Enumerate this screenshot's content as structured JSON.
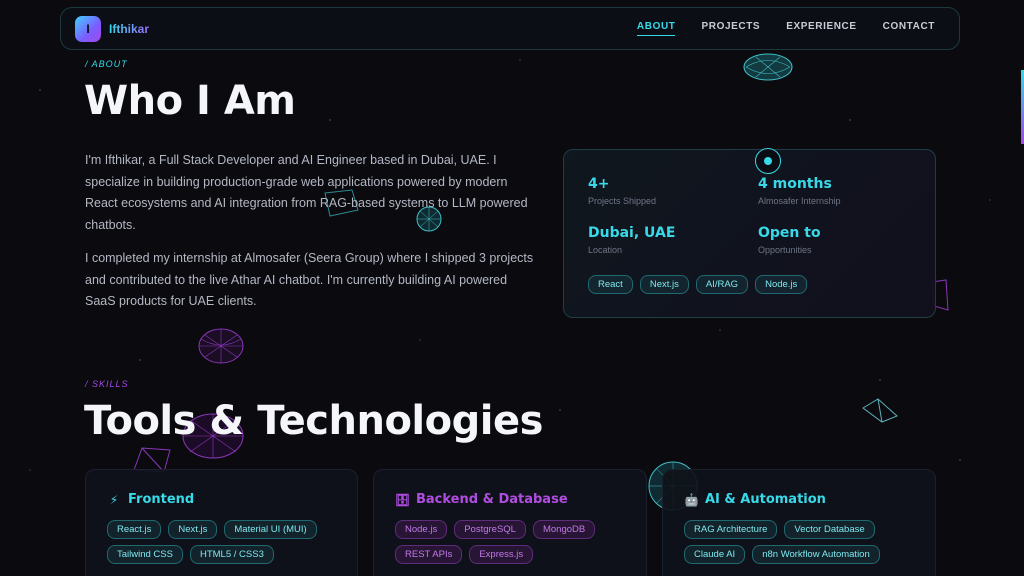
{
  "brand": {
    "initial": "I",
    "name": "Ifthikar"
  },
  "nav": {
    "links": [
      "ABOUT",
      "PROJECTS",
      "EXPERIENCE",
      "CONTACT"
    ],
    "active": "ABOUT"
  },
  "about": {
    "label": "/ ABOUT",
    "title": "Who I Am",
    "bio_1": "I'm Ifthikar, a Full Stack Developer and AI Engineer based in Dubai, UAE. I specialize in building production-grade web applications powered by modern React ecosystems and AI integration from RAG-based systems to LLM powered chatbots.",
    "bio_2": "I completed my internship at Almosafer (Seera Group) where I shipped 3 projects and contributed to the live Athar AI chatbot. I'm currently building AI powered SaaS products for UAE clients."
  },
  "stats": [
    {
      "value": "4+",
      "caption": "Projects Shipped"
    },
    {
      "value": "4 months",
      "caption": "Almosafer Internship"
    },
    {
      "value": "Dubai, UAE",
      "caption": "Location"
    },
    {
      "value": "Open to",
      "caption": "Opportunities"
    }
  ],
  "stat_tags": [
    "React",
    "Next.js",
    "AI/RAG",
    "Node.js"
  ],
  "skills": {
    "label": "/ SKILLS",
    "title": "Tools & Technologies",
    "cards": [
      {
        "icon": "⚡",
        "title": "Frontend",
        "tags": [
          "React.js",
          "Next.js",
          "Material UI (MUI)",
          "Tailwind CSS",
          "HTML5 / CSS3"
        ]
      },
      {
        "icon": "🗄",
        "title": "Backend & Database",
        "tags": [
          "Node.js",
          "PostgreSQL",
          "MongoDB",
          "REST APIs",
          "Express.js"
        ]
      },
      {
        "icon": "🤖",
        "title": "AI & Automation",
        "tags": [
          "RAG Architecture",
          "Vector Database",
          "Claude AI",
          "n8n Workflow Automation"
        ]
      }
    ]
  },
  "colors": {
    "accent_cyan": "#38d9e8",
    "accent_purple": "#a349e6",
    "frontend_title": "#38d9e8",
    "backend_title": "#b04de0",
    "ai_title": "#38d9e8"
  }
}
